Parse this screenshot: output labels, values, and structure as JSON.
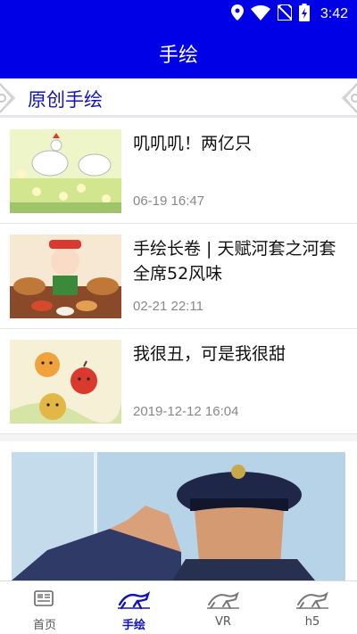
{
  "status_bar": {
    "time": "3:42"
  },
  "app_bar": {
    "title": "手绘"
  },
  "section": {
    "title": "原创手绘"
  },
  "articles": [
    {
      "title": "叽叽叽！两亿只",
      "date": "06-19 16:47"
    },
    {
      "title": "手绘长卷 | 天赋河套之河套全席52风味",
      "date": "02-21 22:11"
    },
    {
      "title": "我很丑，可是我很甜",
      "date": "2019-12-12 16:04"
    }
  ],
  "bottom_nav": {
    "items": [
      {
        "label": "首页",
        "icon": "newspaper-icon",
        "active": false
      },
      {
        "label": "手绘",
        "icon": "horse-icon",
        "active": true
      },
      {
        "label": "VR",
        "icon": "horse-icon",
        "active": false
      },
      {
        "label": "h5",
        "icon": "horse-icon",
        "active": false
      }
    ]
  },
  "colors": {
    "primary": "#0000e6",
    "accent": "#1313b8"
  }
}
